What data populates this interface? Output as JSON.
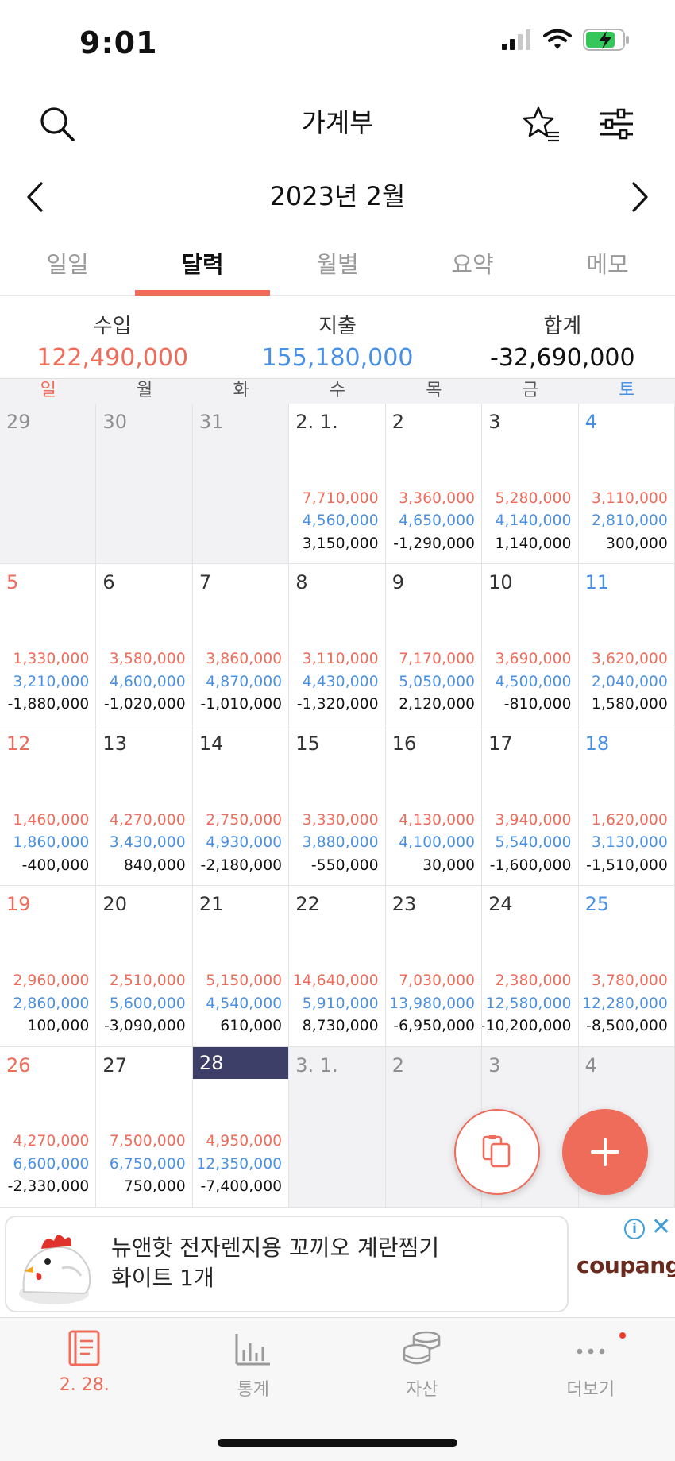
{
  "status_bar": {
    "time": "9:01"
  },
  "header": {
    "title": "가계부"
  },
  "month_nav": {
    "label": "2023년 2월"
  },
  "tabs": [
    {
      "label": "일일",
      "active": false
    },
    {
      "label": "달력",
      "active": true
    },
    {
      "label": "월별",
      "active": false
    },
    {
      "label": "요약",
      "active": false
    },
    {
      "label": "메모",
      "active": false
    }
  ],
  "summary": {
    "income_label": "수입",
    "income_value": "122,490,000",
    "expense_label": "지출",
    "expense_value": "155,180,000",
    "total_label": "합계",
    "total_value": "-32,690,000"
  },
  "weekdays": [
    "일",
    "월",
    "화",
    "수",
    "목",
    "금",
    "토"
  ],
  "calendar": {
    "weeks": [
      [
        {
          "day": "29",
          "other": true
        },
        {
          "day": "30",
          "other": true
        },
        {
          "day": "31",
          "other": true
        },
        {
          "day": "2. 1.",
          "income": "7,710,000",
          "expense": "4,560,000",
          "total": "3,150,000"
        },
        {
          "day": "2",
          "income": "3,360,000",
          "expense": "4,650,000",
          "total": "-1,290,000"
        },
        {
          "day": "3",
          "income": "5,280,000",
          "expense": "4,140,000",
          "total": "1,140,000"
        },
        {
          "day": "4",
          "income": "3,110,000",
          "expense": "2,810,000",
          "total": "300,000"
        }
      ],
      [
        {
          "day": "5",
          "income": "1,330,000",
          "expense": "3,210,000",
          "total": "-1,880,000"
        },
        {
          "day": "6",
          "income": "3,580,000",
          "expense": "4,600,000",
          "total": "-1,020,000"
        },
        {
          "day": "7",
          "income": "3,860,000",
          "expense": "4,870,000",
          "total": "-1,010,000"
        },
        {
          "day": "8",
          "income": "3,110,000",
          "expense": "4,430,000",
          "total": "-1,320,000"
        },
        {
          "day": "9",
          "income": "7,170,000",
          "expense": "5,050,000",
          "total": "2,120,000"
        },
        {
          "day": "10",
          "income": "3,690,000",
          "expense": "4,500,000",
          "total": "-810,000"
        },
        {
          "day": "11",
          "income": "3,620,000",
          "expense": "2,040,000",
          "total": "1,580,000"
        }
      ],
      [
        {
          "day": "12",
          "income": "1,460,000",
          "expense": "1,860,000",
          "total": "-400,000"
        },
        {
          "day": "13",
          "income": "4,270,000",
          "expense": "3,430,000",
          "total": "840,000"
        },
        {
          "day": "14",
          "income": "2,750,000",
          "expense": "4,930,000",
          "total": "-2,180,000"
        },
        {
          "day": "15",
          "income": "3,330,000",
          "expense": "3,880,000",
          "total": "-550,000"
        },
        {
          "day": "16",
          "income": "4,130,000",
          "expense": "4,100,000",
          "total": "30,000"
        },
        {
          "day": "17",
          "income": "3,940,000",
          "expense": "5,540,000",
          "total": "-1,600,000"
        },
        {
          "day": "18",
          "income": "1,620,000",
          "expense": "3,130,000",
          "total": "-1,510,000"
        }
      ],
      [
        {
          "day": "19",
          "income": "2,960,000",
          "expense": "2,860,000",
          "total": "100,000"
        },
        {
          "day": "20",
          "income": "2,510,000",
          "expense": "5,600,000",
          "total": "-3,090,000"
        },
        {
          "day": "21",
          "income": "5,150,000",
          "expense": "4,540,000",
          "total": "610,000"
        },
        {
          "day": "22",
          "income": "14,640,000",
          "expense": "5,910,000",
          "total": "8,730,000"
        },
        {
          "day": "23",
          "income": "7,030,000",
          "expense": "13,980,000",
          "total": "-6,950,000"
        },
        {
          "day": "24",
          "income": "2,380,000",
          "expense": "12,580,000",
          "total": "-10,200,000"
        },
        {
          "day": "25",
          "income": "3,780,000",
          "expense": "12,280,000",
          "total": "-8,500,000"
        }
      ],
      [
        {
          "day": "26",
          "income": "4,270,000",
          "expense": "6,600,000",
          "total": "-2,330,000"
        },
        {
          "day": "27",
          "income": "7,500,000",
          "expense": "6,750,000",
          "total": "750,000"
        },
        {
          "day": "28",
          "today": true,
          "income": "4,950,000",
          "expense": "12,350,000",
          "total": "-7,400,000"
        },
        {
          "day": "3. 1.",
          "other": true
        },
        {
          "day": "2",
          "other": true
        },
        {
          "day": "3",
          "other": true
        },
        {
          "day": "4",
          "other": true
        }
      ]
    ]
  },
  "ad": {
    "text_line1": "뉴앤핫 전자렌지용 꼬끼오 계란찜기",
    "text_line2": "화이트 1개",
    "brand": "coupang",
    "info_glyph": "i",
    "close_glyph": "✕"
  },
  "bottom_nav": [
    {
      "label": "2. 28.",
      "icon": "ledger-book-icon",
      "active": true
    },
    {
      "label": "통계",
      "icon": "bar-stats-icon",
      "active": false
    },
    {
      "label": "자산",
      "icon": "coins-stack-icon",
      "active": false
    },
    {
      "label": "더보기",
      "icon": "more-dots-icon",
      "active": false,
      "badge": true
    }
  ],
  "colors": {
    "accent": "#ef6b5a",
    "income": "#ef6b5a",
    "expense": "#4a90e2",
    "today": "#3e3f68"
  }
}
